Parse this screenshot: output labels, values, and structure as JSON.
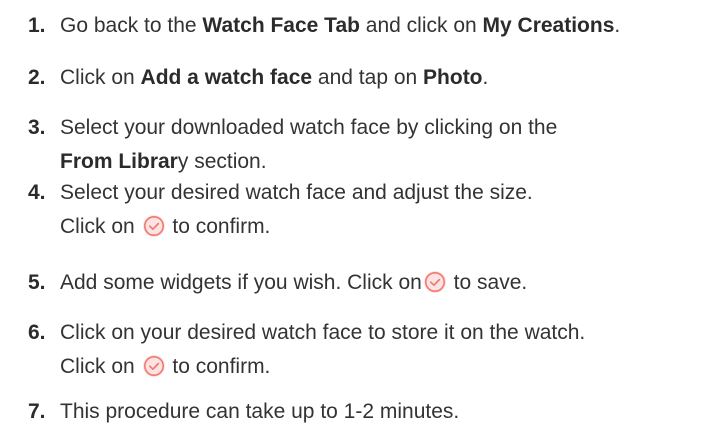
{
  "steps": [
    {
      "number": "1.",
      "line1": {
        "a": "Go back to the ",
        "b": "Watch Face Tab",
        "c": " and click on ",
        "d": "My Creations",
        "e": "."
      }
    },
    {
      "number": "2.",
      "line1": {
        "a": "Click on ",
        "b": "Add a watch face",
        "c": " and tap on ",
        "d": "Photo",
        "e": "."
      }
    },
    {
      "number": "3.",
      "line1": "Select your downloaded watch face by clicking on the",
      "line2": {
        "a": "From Librar",
        "b": "y section."
      }
    },
    {
      "number": "4.",
      "line1": "Select your desired watch face and adjust the size.",
      "line2": {
        "a": "Click on ",
        "b": " to confirm."
      }
    },
    {
      "number": "5.",
      "line1": {
        "a": "Add some widgets if you wish. Click on",
        "b": " to save."
      }
    },
    {
      "number": "6.",
      "line1": "Click on your desired watch face to store it on the watch.",
      "line2": {
        "a": "Click on ",
        "b": " to confirm."
      }
    },
    {
      "number": "7.",
      "line1": "This procedure can take up to 1-2 minutes."
    }
  ],
  "icons": {
    "confirm": "check-circle-icon"
  },
  "colors": {
    "text": "#333333",
    "icon_stroke": "#f07a72",
    "icon_fill": "#fde3e1"
  }
}
